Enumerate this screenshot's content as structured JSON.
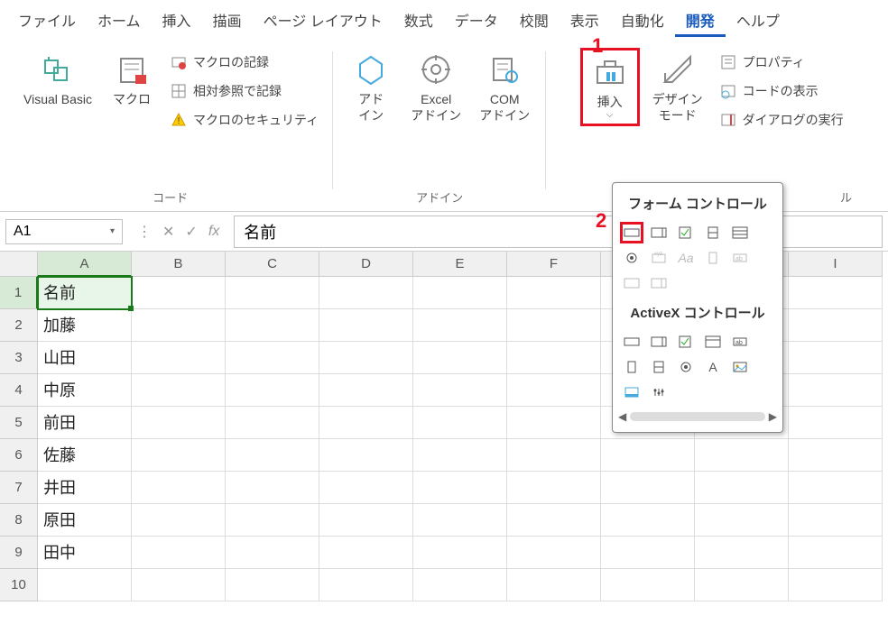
{
  "menu": {
    "items": [
      "ファイル",
      "ホーム",
      "挿入",
      "描画",
      "ページ レイアウト",
      "数式",
      "データ",
      "校閲",
      "表示",
      "自動化",
      "開発",
      "ヘルプ"
    ],
    "active_index": 10
  },
  "ribbon": {
    "group_code": {
      "visual_basic": "Visual Basic",
      "macro": "マクロ",
      "record_macro": "マクロの記録",
      "relative_ref": "相対参照で記録",
      "macro_security": "マクロのセキュリティ",
      "label": "コード"
    },
    "group_addins": {
      "addins": "アド\nイン",
      "excel_addins": "Excel\nアドイン",
      "com_addins": "COM\nアドイン",
      "label": "アドイン"
    },
    "group_controls": {
      "insert": "挿入",
      "design_mode": "デザイン\nモード",
      "properties": "プロパティ",
      "view_code": "コードの表示",
      "run_dialog": "ダイアログの実行",
      "label": "ル"
    }
  },
  "annotations": {
    "one": "1",
    "two": "2"
  },
  "formula": {
    "name_box": "A1",
    "value": "名前"
  },
  "grid": {
    "columns": [
      "A",
      "B",
      "C",
      "D",
      "E",
      "F",
      "",
      "",
      "I"
    ],
    "rows": [
      {
        "n": 1,
        "cells": [
          "名前",
          "",
          "",
          "",
          "",
          "",
          "",
          "",
          ""
        ]
      },
      {
        "n": 2,
        "cells": [
          "加藤",
          "",
          "",
          "",
          "",
          "",
          "",
          "",
          ""
        ]
      },
      {
        "n": 3,
        "cells": [
          "山田",
          "",
          "",
          "",
          "",
          "",
          "",
          "",
          ""
        ]
      },
      {
        "n": 4,
        "cells": [
          "中原",
          "",
          "",
          "",
          "",
          "",
          "",
          "",
          ""
        ]
      },
      {
        "n": 5,
        "cells": [
          "前田",
          "",
          "",
          "",
          "",
          "",
          "",
          "",
          ""
        ]
      },
      {
        "n": 6,
        "cells": [
          "佐藤",
          "",
          "",
          "",
          "",
          "",
          "",
          "",
          ""
        ]
      },
      {
        "n": 7,
        "cells": [
          "井田",
          "",
          "",
          "",
          "",
          "",
          "",
          "",
          ""
        ]
      },
      {
        "n": 8,
        "cells": [
          "原田",
          "",
          "",
          "",
          "",
          "",
          "",
          "",
          ""
        ]
      },
      {
        "n": 9,
        "cells": [
          "田中",
          "",
          "",
          "",
          "",
          "",
          "",
          "",
          ""
        ]
      },
      {
        "n": 10,
        "cells": [
          "",
          "",
          "",
          "",
          "",
          "",
          "",
          "",
          ""
        ]
      }
    ]
  },
  "dropdown": {
    "section1": "フォーム コントロール",
    "section2": "ActiveX コントロール"
  }
}
